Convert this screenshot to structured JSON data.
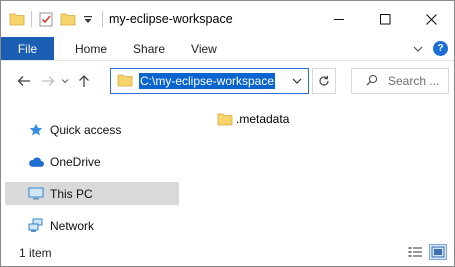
{
  "window": {
    "title": "my-eclipse-workspace"
  },
  "ribbon": {
    "tabs": [
      {
        "label": "File"
      },
      {
        "label": "Home"
      },
      {
        "label": "Share"
      },
      {
        "label": "View"
      }
    ],
    "help_label": "?"
  },
  "address": {
    "path": "C:\\my-eclipse-workspace"
  },
  "search": {
    "placeholder": "Search ..."
  },
  "navpane": {
    "items": [
      {
        "label": "Quick access",
        "icon": "star-icon"
      },
      {
        "label": "OneDrive",
        "icon": "cloud-icon"
      },
      {
        "label": "This PC",
        "icon": "computer-icon",
        "selected": true
      },
      {
        "label": "Network",
        "icon": "network-icon"
      }
    ]
  },
  "content": {
    "items": [
      {
        "name": ".metadata",
        "icon": "folder-icon"
      }
    ]
  },
  "status": {
    "item_count": "1 item"
  },
  "colors": {
    "file_tab": "#1a5fb4",
    "address_highlight": "#0a64d0",
    "address_border": "#2a6fd4",
    "folder": "#f6d36b",
    "selected_nav": "#d9d9d9"
  }
}
